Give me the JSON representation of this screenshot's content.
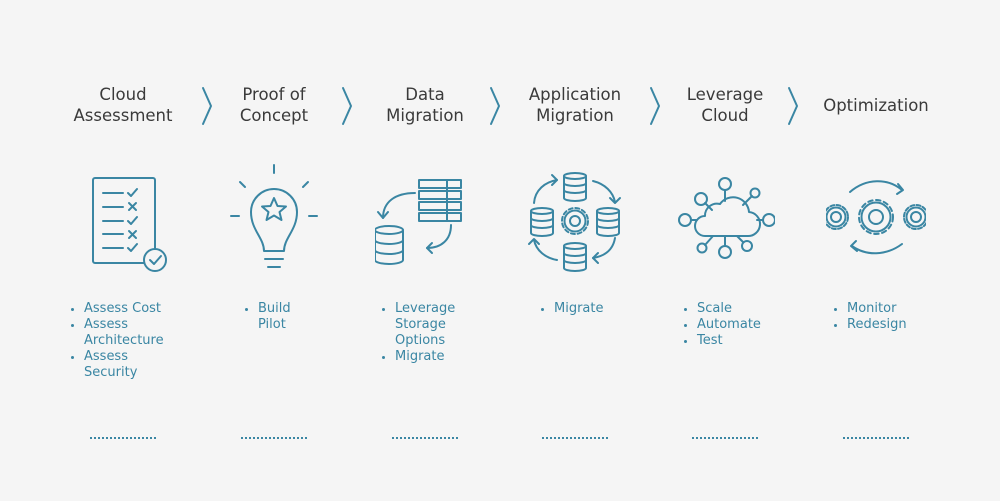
{
  "accent_color": "#3a86a3",
  "steps": [
    {
      "title_lines": [
        "Cloud",
        "Assessment"
      ],
      "icon": "checklist-icon",
      "bullets": [
        "Assess Cost",
        "Assess Architecture",
        "Assess Security"
      ]
    },
    {
      "title_lines": [
        "Proof of",
        "Concept"
      ],
      "icon": "lightbulb-star-icon",
      "bullets": [
        "Build Pilot"
      ]
    },
    {
      "title_lines": [
        "Data",
        "Migration"
      ],
      "icon": "server-to-database-icon",
      "bullets": [
        "Leverage Storage Options",
        "Migrate"
      ]
    },
    {
      "title_lines": [
        "Application",
        "Migration"
      ],
      "icon": "database-cycle-gear-icon",
      "bullets": [
        "Migrate"
      ]
    },
    {
      "title_lines": [
        "Leverage",
        "Cloud"
      ],
      "icon": "cloud-network-icon",
      "bullets": [
        "Scale",
        "Automate",
        "Test"
      ]
    },
    {
      "title_lines": [
        "Optimization"
      ],
      "icon": "gears-cycle-icon",
      "bullets": [
        "Monitor",
        "Redesign"
      ]
    }
  ]
}
